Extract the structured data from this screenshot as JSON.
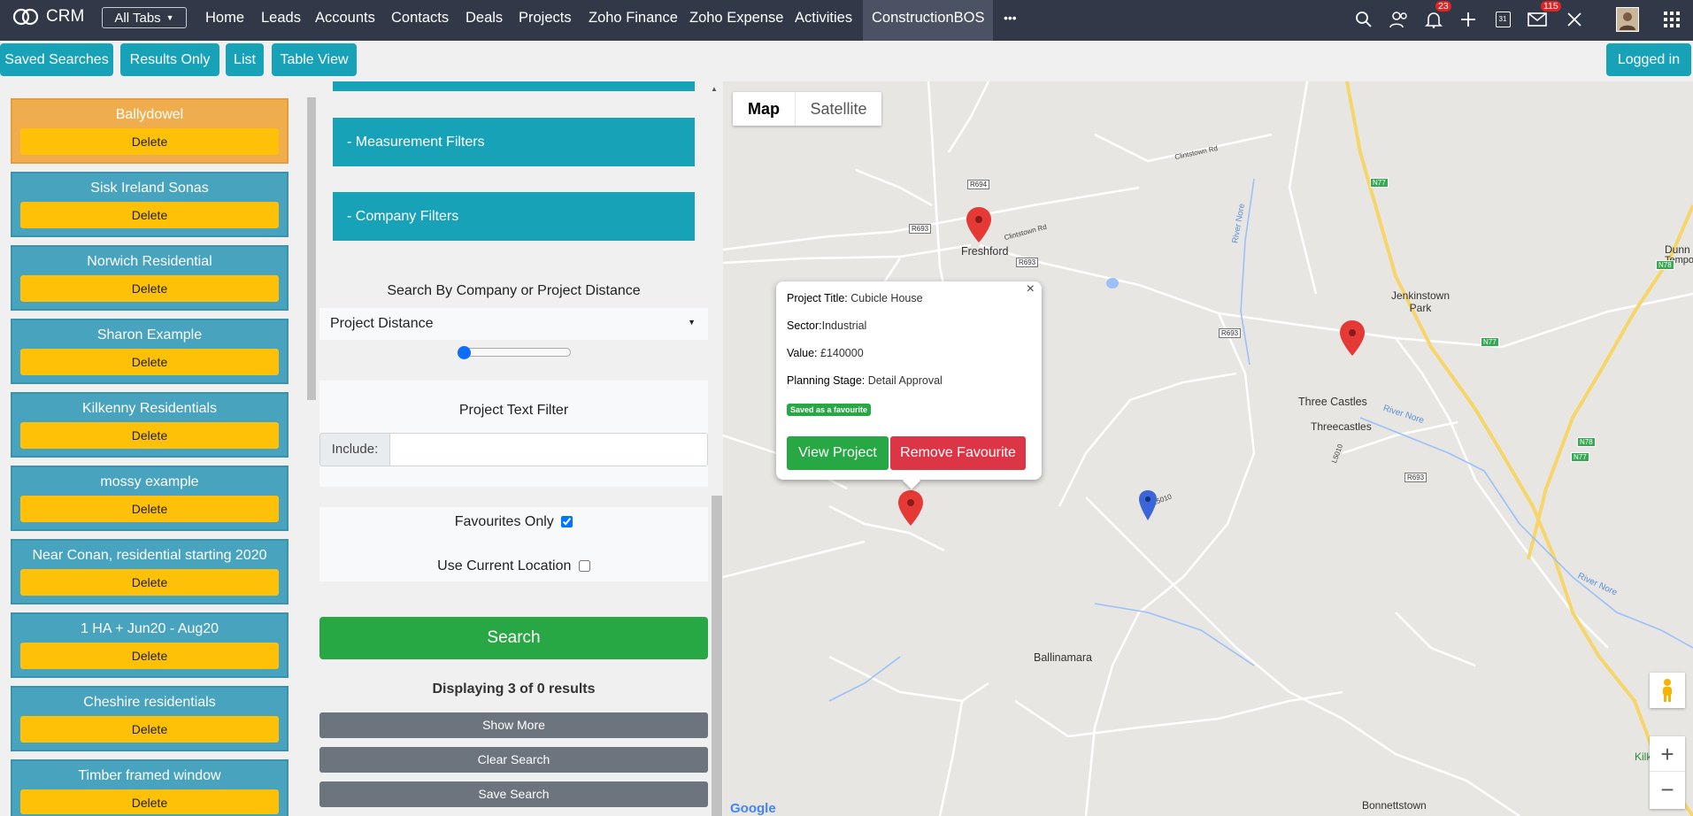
{
  "nav": {
    "brand": "CRM",
    "all_tabs": "All Tabs",
    "items": [
      "Home",
      "Leads",
      "Accounts",
      "Contacts",
      "Deals",
      "Projects",
      "Zoho Finance",
      "Zoho Expense",
      "Activities",
      "ConstructionBOS"
    ],
    "more": "•••",
    "notifications_count": "23",
    "mail_count": "115",
    "calendar_day": "31"
  },
  "toolbar": {
    "saved_searches": "Saved Searches",
    "results_only": "Results Only",
    "list": "List",
    "table_view": "Table View",
    "logged_in": "Logged in"
  },
  "saved_searches": {
    "delete_label": "Delete",
    "items": [
      "Ballydowel",
      "Sisk Ireland Sonas",
      "Norwich Residential",
      "Sharon Example",
      "Kilkenny Residentials",
      "mossy example",
      "Near Conan, residential starting 2020",
      "1 HA + Jun20 - Aug20",
      "Cheshire residentials",
      "Timber framed window"
    ]
  },
  "filters": {
    "measurement": "- Measurement Filters",
    "company": "- Company Filters",
    "distance_heading": "Search By Company or Project Distance",
    "distance_select": "Project Distance",
    "distance_slider": 0,
    "text_filter_heading": "Project Text Filter",
    "include_label": "Include:",
    "include_value": "",
    "favourites_only": "Favourites Only",
    "favourites_checked": true,
    "use_location": "Use Current Location",
    "use_location_checked": false,
    "search": "Search",
    "results_text": "Displaying 3 of 0 results",
    "show_more": "Show More",
    "clear_search": "Clear Search",
    "save_search": "Save Search"
  },
  "map": {
    "map_tab": "Map",
    "satellite_tab": "Satellite",
    "places": [
      "Freshford",
      "Jenkinstown Park",
      "Three Castles",
      "Threecastles",
      "Ballinamara",
      "Bonnettstown",
      "Dunn",
      "Tempo",
      "Kilk"
    ],
    "roads": [
      "R694",
      "R693",
      "R693",
      "R693",
      "R693",
      "N77",
      "N77",
      "N77",
      "N78",
      "N78",
      "L5010",
      "L5010",
      "Clintstown Rd",
      "Clintstown Rd"
    ],
    "rivers": [
      "River Nore",
      "River Nore",
      "River Nore"
    ],
    "google": "Google",
    "zoom_in": "+",
    "zoom_out": "−"
  },
  "popup": {
    "title_label": "Project Title:",
    "title_value": "Cubicle House",
    "sector_label": "Sector:",
    "sector_value": "Industrial",
    "value_label": "Value:",
    "value_value": "£140000",
    "stage_label": "Planning Stage:",
    "stage_value": "Detail Approval",
    "favourite_badge": "Saved as a favourite",
    "view_project": "View Project",
    "remove_favourite": "Remove Favourite",
    "close": "×"
  },
  "colors": {
    "teal": "#17a2b8",
    "green": "#28a745",
    "red": "#dc3545",
    "yellow": "#ffc107",
    "navbar": "#313949"
  }
}
